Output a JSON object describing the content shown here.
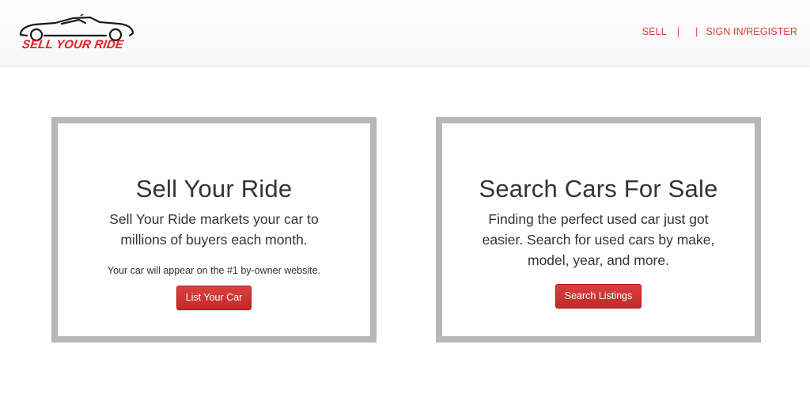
{
  "brand": {
    "logo_text": "SELL YOUR RIDE",
    "accent_color": "#e21d25"
  },
  "nav": {
    "sell": "SELL",
    "separator": "|",
    "sign_in": "SIGN IN/REGISTER"
  },
  "cards": [
    {
      "title": "Sell Your Ride",
      "description": "Sell Your Ride markets your car to millions of buyers each month.",
      "note": "Your car will appear on the #1 by-owner website.",
      "button": "List Your Car"
    },
    {
      "title": "Search Cars For Sale",
      "description": "Finding the perfect used car just got easier. Search for used cars by make, model, year, and more.",
      "button": "Search Listings"
    }
  ],
  "icons": {
    "logo": "sports-car-icon"
  }
}
